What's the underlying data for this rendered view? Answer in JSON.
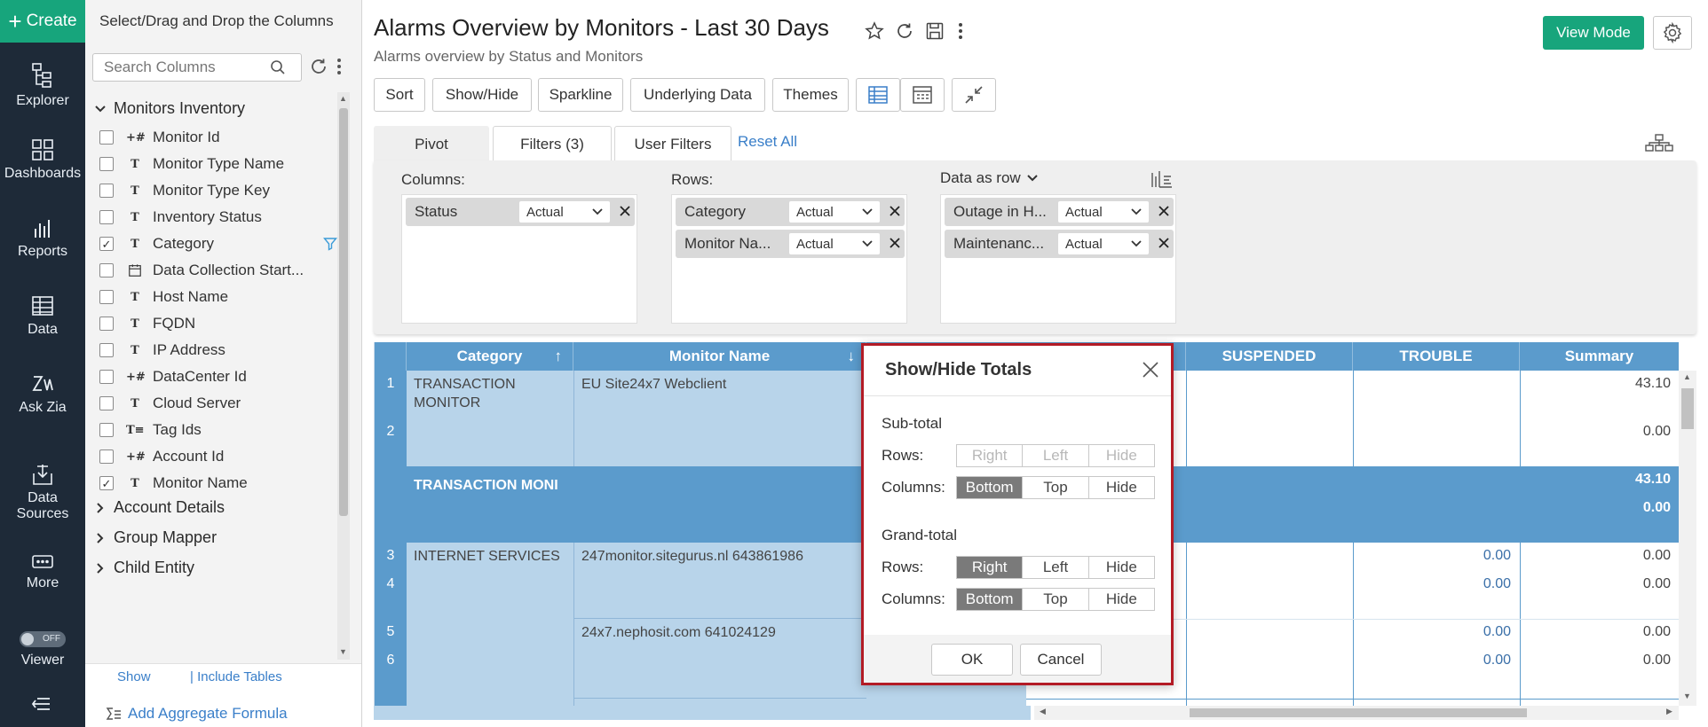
{
  "nav": {
    "create": "Create",
    "items": [
      "Explorer",
      "Dashboards",
      "Reports",
      "Data",
      "Ask Zia",
      "Data Sources",
      "More"
    ],
    "viewer_toggle": "OFF",
    "viewer_label": "Viewer"
  },
  "columns_panel": {
    "title": "Select/Drag and Drop the Columns",
    "search_placeholder": "Search Columns",
    "group_open": "Monitors Inventory",
    "columns": [
      {
        "label": "Monitor Id",
        "type": "+#",
        "checked": false
      },
      {
        "label": "Monitor Type Name",
        "type": "T",
        "checked": false
      },
      {
        "label": "Monitor Type Key",
        "type": "T",
        "checked": false
      },
      {
        "label": "Inventory Status",
        "type": "T",
        "checked": false
      },
      {
        "label": "Category",
        "type": "T",
        "checked": true
      },
      {
        "label": "Data Collection Start...",
        "type": "date",
        "checked": false
      },
      {
        "label": "Host Name",
        "type": "T",
        "checked": false
      },
      {
        "label": "FQDN",
        "type": "T",
        "checked": false
      },
      {
        "label": "IP Address",
        "type": "T",
        "checked": false
      },
      {
        "label": "DataCenter Id",
        "type": "+#",
        "checked": false
      },
      {
        "label": "Cloud Server",
        "type": "T",
        "checked": false
      },
      {
        "label": "Tag Ids",
        "type": "T≡",
        "checked": false
      },
      {
        "label": "Account Id",
        "type": "+#",
        "checked": false
      },
      {
        "label": "Monitor Name",
        "type": "T",
        "checked": true
      }
    ],
    "groups_closed": [
      "Account Details",
      "Group Mapper",
      "Child Entity"
    ],
    "footer": {
      "show": "Show",
      "include_tables": "| Include Tables",
      "add_aggregate": "Add Aggregate Formula"
    }
  },
  "header": {
    "title": "Alarms Overview by Monitors - Last 30 Days",
    "subtitle": "Alarms overview by Status and Monitors",
    "view_mode": "View Mode"
  },
  "toolbar": [
    "Sort",
    "Show/Hide",
    "Sparkline",
    "Underlying Data",
    "Themes"
  ],
  "pivot": {
    "tabs": [
      "Pivot",
      "Filters  (3)",
      "User Filters"
    ],
    "reset_all": "Reset All",
    "columns_label": "Columns:",
    "rows_label": "Rows:",
    "data_label": "Data as row",
    "columns_chips": [
      {
        "label": "Status",
        "agg": "Actual"
      }
    ],
    "rows_chips": [
      {
        "label": "Category",
        "agg": "Actual"
      },
      {
        "label": "Monitor Na...",
        "agg": "Actual"
      }
    ],
    "data_chips": [
      {
        "label": "Outage in H...",
        "agg": "Actual"
      },
      {
        "label": "Maintenanc...",
        "agg": "Actual"
      }
    ]
  },
  "grid": {
    "headers": {
      "category": "Category",
      "monitor": "Monitor Name",
      "suspended": "SUSPENDED",
      "trouble": "TROUBLE",
      "summary": "Summary"
    },
    "rownums": [
      "1",
      "2",
      "3",
      "4",
      "5",
      "6"
    ],
    "cat1": "TRANSACTION MONITOR",
    "mon1": "EU Site24x7 Webclient",
    "subtotal_label": "TRANSACTION MONI",
    "cat2": "INTERNET SERVICES",
    "mon2": "247monitor.sitegurus.nl 643861986",
    "mon3": "24x7.nephosit.com 641024129",
    "summary_values": [
      "43.10",
      "0.00"
    ],
    "subtotal_values": [
      "43.10",
      "0.00"
    ],
    "trouble_values": [
      "0.00",
      "0.00",
      "0.00",
      "0.00"
    ],
    "summary_values_2": [
      "0.00",
      "0.00",
      "0.00",
      "0.00"
    ]
  },
  "modal": {
    "title": "Show/Hide Totals",
    "subtotal": "Sub-total",
    "grandtotal": "Grand-total",
    "rows_label": "Rows:",
    "columns_label": "Columns:",
    "row_opts": [
      "Right",
      "Left",
      "Hide"
    ],
    "col_opts": [
      "Bottom",
      "Top",
      "Hide"
    ],
    "ok": "OK",
    "cancel": "Cancel"
  }
}
